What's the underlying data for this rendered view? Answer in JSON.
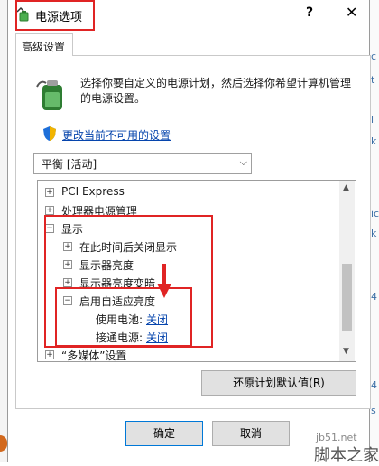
{
  "window": {
    "title": "电源选项",
    "help_glyph": "?",
    "close_glyph": "✕"
  },
  "tabs": [
    {
      "label": "高级设置",
      "active": true
    }
  ],
  "description": "选择你要自定义的电源计划，然后选择你希望计算机管理的电源设置。",
  "change_link": "更改当前不可用的设置",
  "plan_select": {
    "value": "平衡 [活动]"
  },
  "tree": {
    "items": [
      {
        "label": "PCI Express",
        "expander": "+"
      },
      {
        "label": "处理器电源管理",
        "expander": "+"
      },
      {
        "label": "显示",
        "expander": "−"
      },
      {
        "label": "在此时间后关闭显示",
        "expander": "+"
      },
      {
        "label": "显示器亮度",
        "expander": "+"
      },
      {
        "label": "显示器亮度变暗",
        "expander": "+"
      },
      {
        "label": "启用自适应亮度",
        "expander": "−"
      },
      {
        "label": "使用电池:",
        "value": "关闭"
      },
      {
        "label": "接通电源:",
        "value": "关闭"
      },
      {
        "label": "“多媒体”设置",
        "expander": "+"
      }
    ]
  },
  "buttons": {
    "restore": "还原计划默认值(R)",
    "ok": "确定",
    "cancel": "取消"
  },
  "watermark": {
    "url": "jb51.net",
    "brand": "脚本之家"
  },
  "background_app": {
    "chars": [
      "c",
      "t",
      "l",
      "k",
      "ic",
      "k",
      "4",
      "4",
      "s"
    ]
  },
  "colors": {
    "highlight": "#e02424",
    "link": "#0645ad",
    "accent": "#0078d7"
  }
}
